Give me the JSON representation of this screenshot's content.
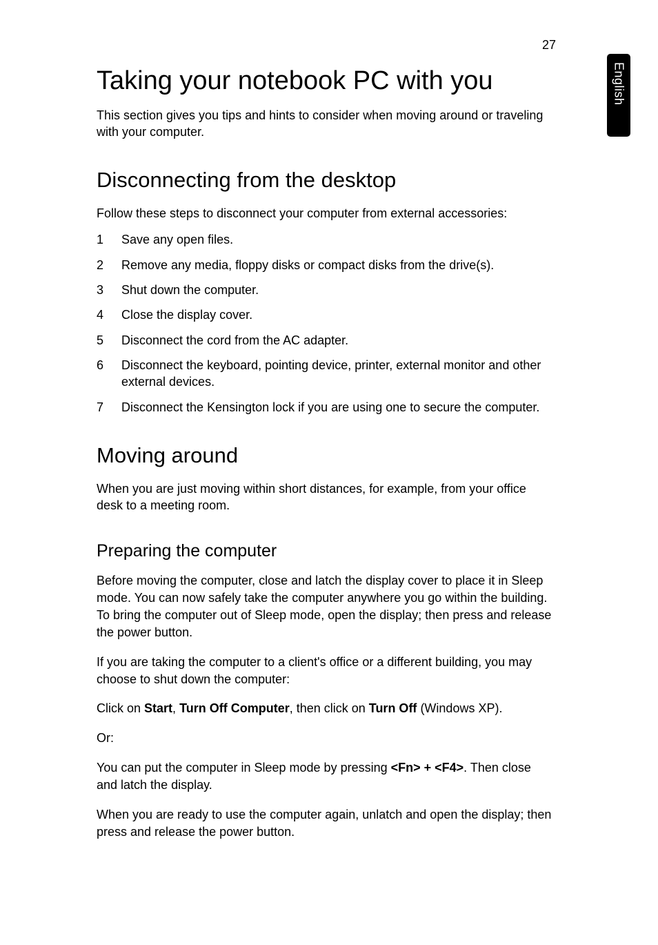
{
  "page_number": "27",
  "side_tab": "English",
  "h1": "Taking your notebook PC with you",
  "intro": "This section gives you tips and hints to consider when moving around or traveling with your computer.",
  "section1": {
    "heading": "Disconnecting from the desktop",
    "lead": "Follow these steps to disconnect your computer from external accessories:",
    "items": [
      {
        "num": "1",
        "text": "Save any open files."
      },
      {
        "num": "2",
        "text": "Remove any media, floppy disks or compact disks from the drive(s)."
      },
      {
        "num": "3",
        "text": "Shut down the computer."
      },
      {
        "num": "4",
        "text": "Close the display cover."
      },
      {
        "num": "5",
        "text": "Disconnect the cord from the AC adapter."
      },
      {
        "num": "6",
        "text": "Disconnect the keyboard, pointing device, printer, external monitor and other external devices."
      },
      {
        "num": "7",
        "text": "Disconnect the Kensington lock if you are using one to secure the computer."
      }
    ]
  },
  "section2": {
    "heading": "Moving around",
    "lead": "When you are just moving within short distances, for example, from your office desk to a meeting room."
  },
  "section3": {
    "heading": "Preparing the computer",
    "p1": "Before moving the computer, close and latch the display cover to place it in Sleep mode. You can now safely take the computer anywhere you go within the building. To bring the computer out of Sleep mode, open the display; then press and release the power button.",
    "p2": "If you are taking the computer to a client's office or a different building, you may choose to shut down the computer:",
    "p3_pre": "Click on ",
    "p3_b1": "Start",
    "p3_mid1": ", ",
    "p3_b2": "Turn Off Computer",
    "p3_mid2": ", then click on ",
    "p3_b3": "Turn Off",
    "p3_post": " (Windows XP).",
    "p4": "Or:",
    "p5_pre": "You can put the computer in Sleep mode by pressing ",
    "p5_b1": "<Fn> + <F4>",
    "p5_post": ". Then close and latch the display.",
    "p6": "When you are ready to use the computer again, unlatch and open the display; then press and release the power button."
  }
}
